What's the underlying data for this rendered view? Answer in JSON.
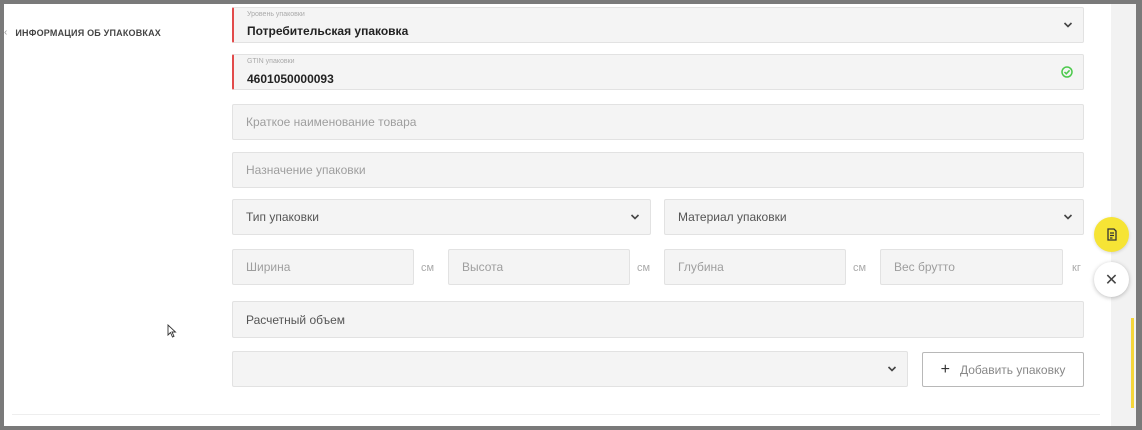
{
  "section": {
    "title": "ИНФОРМАЦИЯ ОБ УПАКОВКАХ"
  },
  "form": {
    "package_level": {
      "label": "Уровень упаковки",
      "value": "Потребительская упаковка"
    },
    "gtin": {
      "label": "GTIN упаковки",
      "value": "4601050000093"
    },
    "short_name": {
      "placeholder": "Краткое наименование товара"
    },
    "purpose": {
      "placeholder": "Назначение упаковки"
    },
    "package_type": {
      "placeholder": "Тип упаковки"
    },
    "package_material": {
      "placeholder": "Материал упаковки"
    },
    "width": {
      "placeholder": "Ширина",
      "unit": "см"
    },
    "height": {
      "placeholder": "Высота",
      "unit": "см"
    },
    "depth": {
      "placeholder": "Глубина",
      "unit": "см"
    },
    "gross_weight": {
      "placeholder": "Вес брутто",
      "unit": "кг"
    },
    "volume": {
      "placeholder": "Расчетный объем"
    },
    "add_select": {
      "value": ""
    },
    "add_button": {
      "label": "Добавить упаковку"
    }
  },
  "colors": {
    "accent_error": "#e24b4b",
    "valid_check": "#4cc94c",
    "fab_yellow": "#f6e435"
  },
  "icons": {
    "section_toggle": "chevron-left-icon",
    "select_arrow": "chevron-down-icon",
    "valid": "check-circle-icon",
    "add": "plus-icon",
    "notes": "notes-icon",
    "close": "close-icon",
    "cursor": "mouse-cursor-icon"
  }
}
